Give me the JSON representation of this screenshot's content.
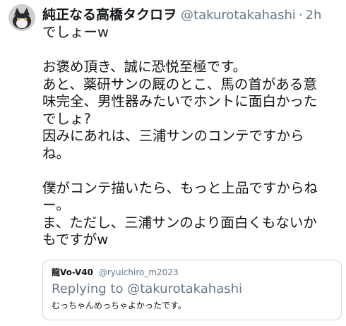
{
  "tweet": {
    "display_name": "純正なる高橋タクロヲ",
    "handle": "@takurotakahashi",
    "separator": "·",
    "time": "2h",
    "lines": [
      "でしょーw",
      "",
      "お褒め頂き、誠に恐悦至極です。",
      "あと、薬研サンの厩のとこ、馬の首がある意",
      "味完全、男性器みたいでホントに面白かった",
      "でしょ?",
      "因みにあれは、三浦サンのコンテですから",
      "ね。",
      "",
      "僕がコンテ描いたら、もっと上品ですからね",
      "ー。",
      "ま、ただし、三浦サンのより面白くもないか",
      "もですがw"
    ]
  },
  "quoted": {
    "display_name": "龍Vo-V40",
    "handle": "@ryuichiro_m2023",
    "replying_to": "Replying to @takurotakahashi",
    "text": "むっちゃんめっちゃよかったです。"
  },
  "colors": {
    "primary_text": "#14171a",
    "secondary_text": "#657786",
    "border": "#ccd6dd"
  }
}
